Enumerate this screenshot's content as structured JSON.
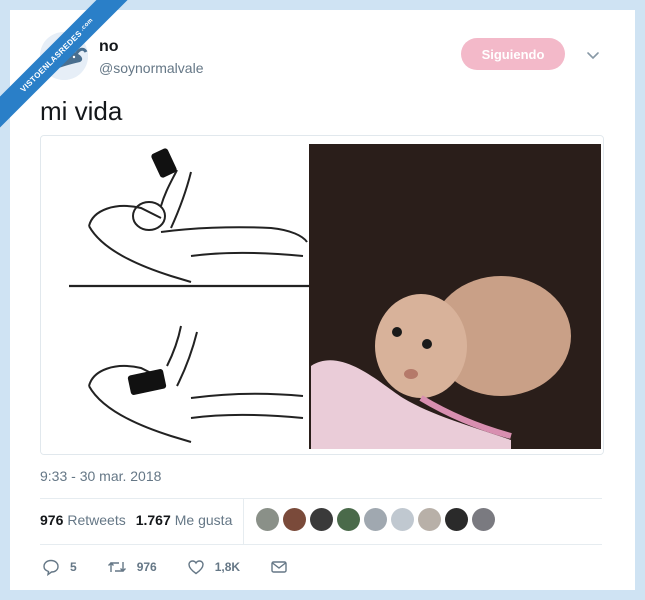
{
  "watermark": {
    "label": "VISTOENLASREDES",
    "suffix": ".com"
  },
  "user": {
    "display_name": "no",
    "handle": "@soynormalvale"
  },
  "follow_button": {
    "label": "Siguiendo",
    "color": "#f3b9c9"
  },
  "tweet": {
    "text": "mi vida",
    "timestamp": "9:33 - 30 mar. 2018"
  },
  "stats": {
    "retweets_count": "976",
    "retweets_label": "Retweets",
    "likes_count": "1.767",
    "likes_label": "Me gusta"
  },
  "likers": [
    "#8a9088",
    "#7a4a3a",
    "#3a3a3a",
    "#4a6a4a",
    "#a0a8b0",
    "#c0c8d0",
    "#b8b0a8",
    "#2a2a2a",
    "#7a7a80"
  ],
  "actions": {
    "replies": "5",
    "retweets": "976",
    "likes": "1,8K"
  },
  "colors": {
    "background": "#cfe3f3",
    "ribbon": "#2a7fc8",
    "text_secondary": "#657786"
  }
}
